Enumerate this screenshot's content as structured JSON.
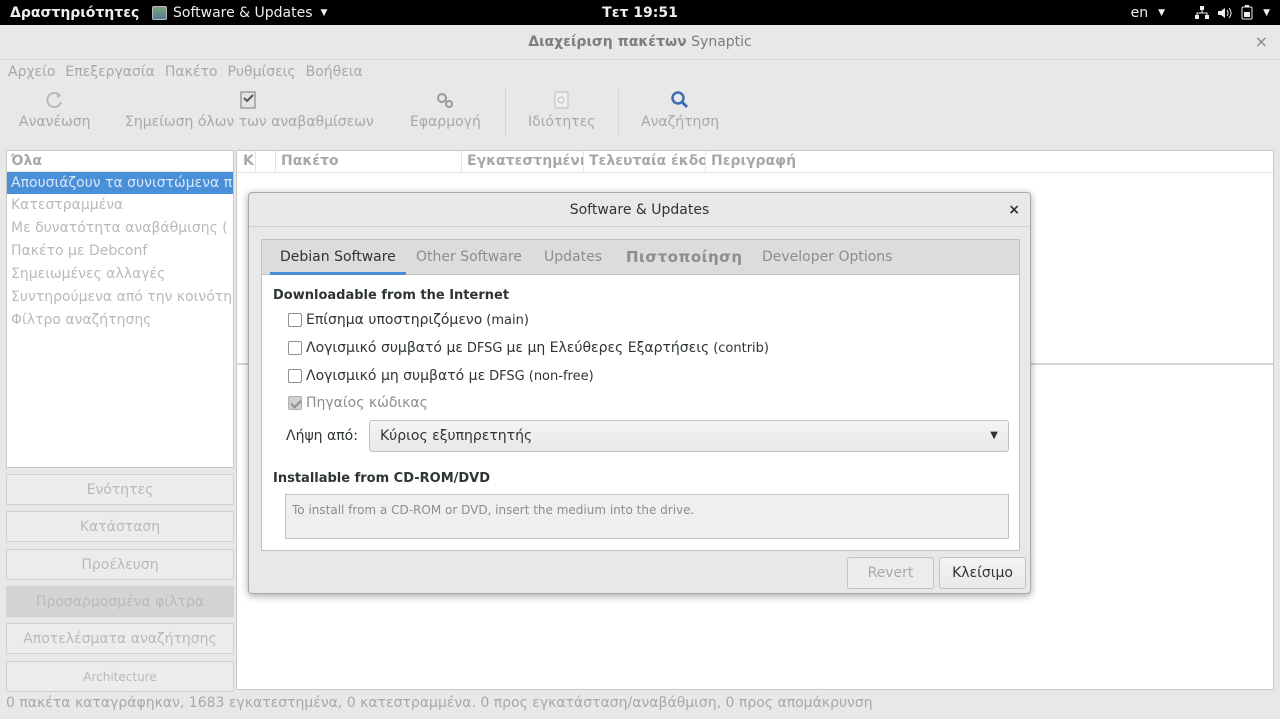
{
  "topbar": {
    "activities": "Δραστηριότητες",
    "app_name": "Software & Updates",
    "clock": "Τετ 19:51",
    "lang": "en"
  },
  "window": {
    "title_bold": "Διαχείριση πακέτων",
    "title_rest": "Synaptic",
    "close": "×"
  },
  "menubar": [
    "Αρχείο",
    "Επεξεργασία",
    "Πακέτο",
    "Ρυθμίσεις",
    "Βοήθεια"
  ],
  "toolbar": {
    "reload": "Ανανέωση",
    "mark_all": "Σημείωση όλων των αναβαθμίσεων",
    "apply": "Εφαρμογή",
    "properties": "Ιδιότητες",
    "search": "Αναζήτηση"
  },
  "filters": {
    "header": "Όλα",
    "items": [
      "Απουσιάζουν τα συνιστώμενα π",
      "Κατεστραμμένα",
      "Με δυνατότητα αναβάθμισης (",
      "Πακέτο με Debconf",
      "Σημειωμένες αλλαγές",
      "Συντηρούμενα από την κοινότη",
      "Φίλτρο αναζήτησης"
    ]
  },
  "left_buttons": {
    "sections": "Ενότητες",
    "status": "Κατάσταση",
    "origin": "Προέλευση",
    "custom": "Προσαρμοσμένα φίλτρα",
    "results": "Αποτελέσματα αναζήτησης",
    "arch": "Architecture"
  },
  "package_columns": {
    "s": "Κ",
    "package": "Πακέτο",
    "installed": "Εγκατεστημένι",
    "latest": "Τελευταία έκδο",
    "description": "Περιγραφή"
  },
  "statusbar": "0 πακέτα καταγράφηκαν, 1683 εγκατεστημένα, 0 κατεστραμμένα. 0 προς εγκατάσταση/αναβάθμιση, 0 προς απομάκρυνση",
  "dialog": {
    "title": "Software & Updates",
    "close": "×",
    "tabs": {
      "debian": "Debian Software",
      "other": "Other Software",
      "updates": "Updates",
      "auth": "Πιστοποίηση",
      "dev": "Developer Options"
    },
    "downloadable_header": "Downloadable from the Internet",
    "checks": {
      "main_label": "Επίσημα υποστηριζόμενο",
      "main_tag": "(main)",
      "contrib_label": "Λογισμικό συμβατό με",
      "contrib_mid": "DFSG",
      "contrib_label2": "με μη Ελεύθερες Εξαρτήσεις",
      "contrib_tag": "(contrib)",
      "nonfree_label": "Λογισμικό μη συμβατό με",
      "nonfree_mid": "DFSG",
      "nonfree_tag": "(non-free)",
      "source_label": "Πηγαίος κώδικας"
    },
    "download_from_label": "Λήψη από:",
    "download_from_value": "Κύριος εξυπηρετητής",
    "cdrom_header": "Installable from CD-ROM/DVD",
    "cdrom_text": "To install from a CD-ROM or DVD, insert the medium into the drive.",
    "revert": "Revert",
    "close_button": "Κλείσιμο"
  }
}
